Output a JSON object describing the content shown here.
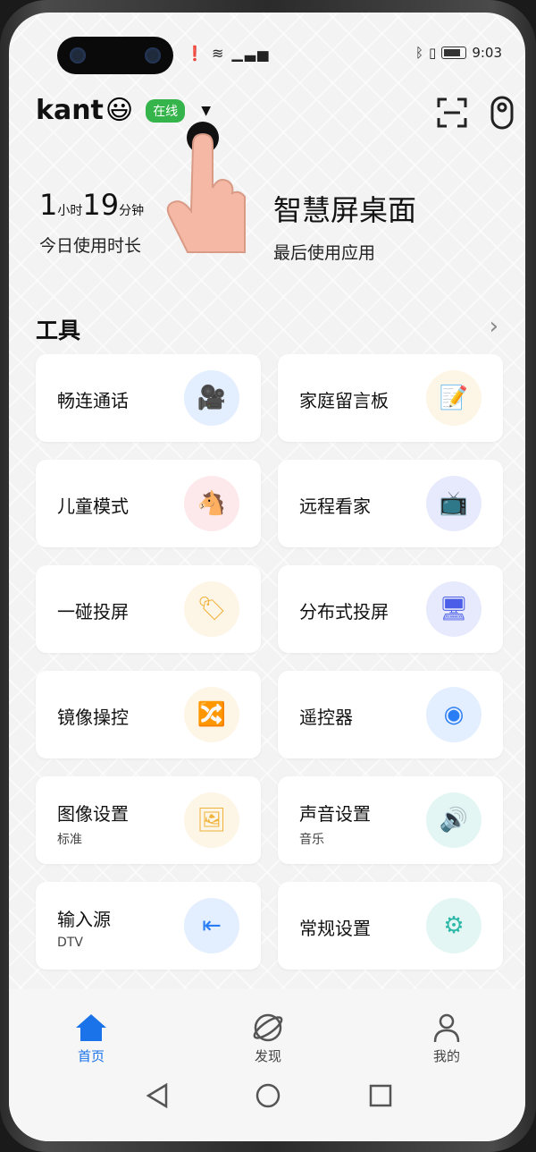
{
  "status_bar": {
    "time": "9:03"
  },
  "header": {
    "username": "kant",
    "emoji": "😃",
    "online_badge": "在线"
  },
  "stats": {
    "usage_hours": "1",
    "usage_hours_unit": "小时",
    "usage_minutes": "19",
    "usage_minutes_unit": "分钟",
    "usage_label": "今日使用时长",
    "last_app": "智慧屏桌面",
    "last_app_label": "最后使用应用"
  },
  "tools": {
    "title": "工具",
    "items": [
      {
        "label": "畅连通话",
        "sub": "",
        "icon": "video-call-icon",
        "color": "#2a7ef5"
      },
      {
        "label": "家庭留言板",
        "sub": "",
        "icon": "note-icon",
        "color": "#f3b53a"
      },
      {
        "label": "儿童模式",
        "sub": "",
        "icon": "rocking-horse-icon",
        "color": "#ef5a6a"
      },
      {
        "label": "远程看家",
        "sub": "",
        "icon": "tv-camera-icon",
        "color": "#4a5ee8"
      },
      {
        "label": "一碰投屏",
        "sub": "",
        "icon": "nfc-tag-icon",
        "color": "#f0b23a"
      },
      {
        "label": "分布式投屏",
        "sub": "",
        "icon": "multi-screen-icon",
        "color": "#4a5ee8"
      },
      {
        "label": "镜像操控",
        "sub": "",
        "icon": "mirror-control-icon",
        "color": "#f0b23a"
      },
      {
        "label": "遥控器",
        "sub": "",
        "icon": "remote-control-icon",
        "color": "#2a7ef5"
      },
      {
        "label": "图像设置",
        "sub": "标准",
        "icon": "image-icon",
        "color": "#f0b23a"
      },
      {
        "label": "声音设置",
        "sub": "音乐",
        "icon": "speaker-icon",
        "color": "#2bb8a8"
      },
      {
        "label": "输入源",
        "sub": "DTV",
        "icon": "input-source-icon",
        "color": "#2a7ef5"
      },
      {
        "label": "常规设置",
        "sub": "",
        "icon": "gear-icon",
        "color": "#2bb8a8"
      }
    ]
  },
  "bottom_nav": [
    {
      "label": "首页",
      "icon": "home-icon",
      "active": true
    },
    {
      "label": "发现",
      "icon": "planet-icon",
      "active": false
    },
    {
      "label": "我的",
      "icon": "person-icon",
      "active": false
    }
  ]
}
